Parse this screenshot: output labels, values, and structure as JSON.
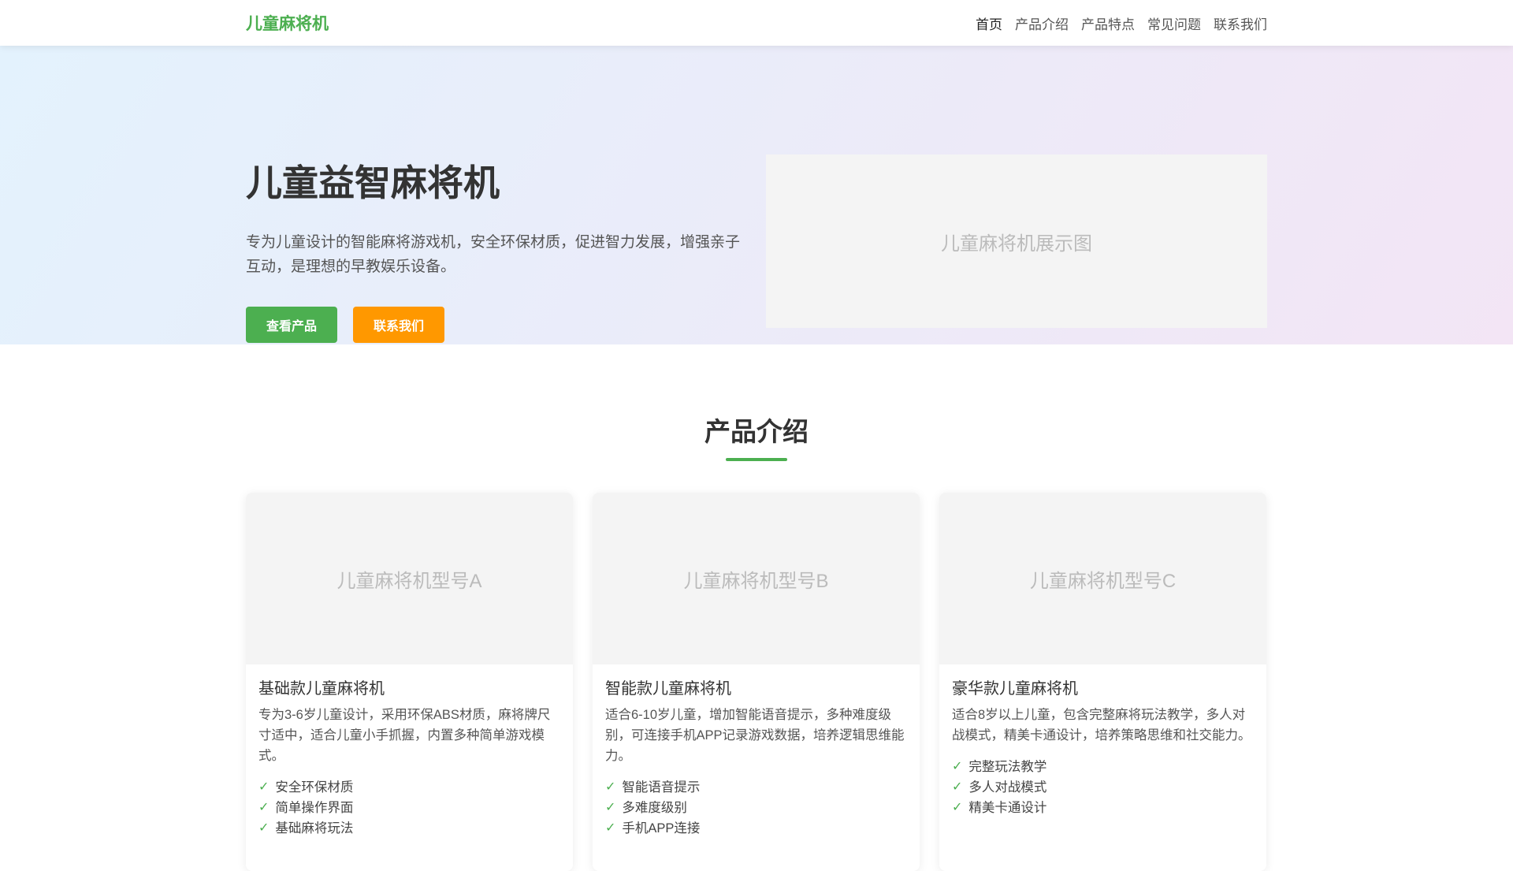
{
  "nav": {
    "logo": "儿童麻将机",
    "items": [
      "首页",
      "产品介绍",
      "产品特点",
      "常见问题",
      "联系我们"
    ]
  },
  "hero": {
    "title": "儿童益智麻将机",
    "description": "专为儿童设计的智能麻将游戏机，安全环保材质，促进智力发展，增强亲子互动，是理想的早教娱乐设备。",
    "btn_products": "查看产品",
    "btn_contact": "联系我们",
    "image_alt": "儿童麻将机展示图"
  },
  "products": {
    "title": "产品介绍",
    "cards": [
      {
        "image": "儿童麻将机型号A",
        "name": "基础款儿童麻将机",
        "desc": "专为3-6岁儿童设计，采用环保ABS材质，麻将牌尺寸适中，适合儿童小手抓握，内置多种简单游戏模式。",
        "features": [
          "安全环保材质",
          "简单操作界面",
          "基础麻将玩法"
        ]
      },
      {
        "image": "儿童麻将机型号B",
        "name": "智能款儿童麻将机",
        "desc": "适合6-10岁儿童，增加智能语音提示，多种难度级别，可连接手机APP记录游戏数据，培养逻辑思维能力。",
        "features": [
          "智能语音提示",
          "多难度级别",
          "手机APP连接"
        ]
      },
      {
        "image": "儿童麻将机型号C",
        "name": "豪华款儿童麻将机",
        "desc": "适合8岁以上儿童，包含完整麻将玩法教学，多人对战模式，精美卡通设计，培养策略思维和社交能力。",
        "features": [
          "完整玩法教学",
          "多人对战模式",
          "精美卡通设计"
        ]
      }
    ]
  },
  "icons": {
    "feature": "check-icon"
  },
  "colors": {
    "primary": "#4caf50",
    "accent": "#ff9800"
  }
}
